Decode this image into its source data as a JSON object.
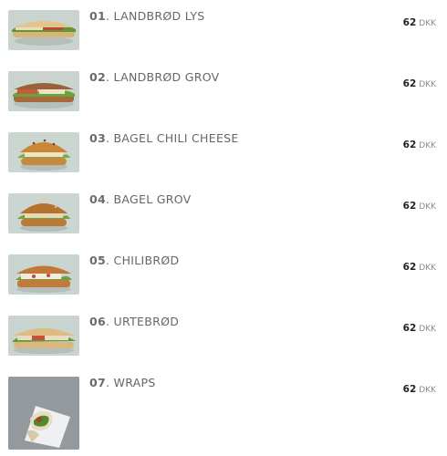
{
  "menu": {
    "items": [
      {
        "number": "01",
        "name": "LANDBRØD LYS",
        "price": "62",
        "currency": "DKK",
        "image": "bread-sandwich-light"
      },
      {
        "number": "02",
        "name": "LANDBRØD GROV",
        "price": "62",
        "currency": "DKK",
        "image": "bread-sandwich-dark"
      },
      {
        "number": "03",
        "name": "BAGEL CHILI CHEESE",
        "price": "62",
        "currency": "DKK",
        "image": "bagel-sandwich"
      },
      {
        "number": "04",
        "name": "BAGEL GROV",
        "price": "62",
        "currency": "DKK",
        "image": "bagel-sandwich"
      },
      {
        "number": "05",
        "name": "CHILIBRØD",
        "price": "62",
        "currency": "DKK",
        "image": "chili-bread-sandwich"
      },
      {
        "number": "06",
        "name": "URTEBRØD",
        "price": "62",
        "currency": "DKK",
        "image": "herb-bread-sandwich"
      },
      {
        "number": "07",
        "name": "WRAPS",
        "price": "62",
        "currency": "DKK",
        "image": "wrap"
      }
    ]
  },
  "colors": {
    "title": "#666666",
    "number": "#6b6b6b",
    "price": "#222222",
    "currency": "#8a8a8a",
    "image_bg": "#c9d6cf"
  }
}
